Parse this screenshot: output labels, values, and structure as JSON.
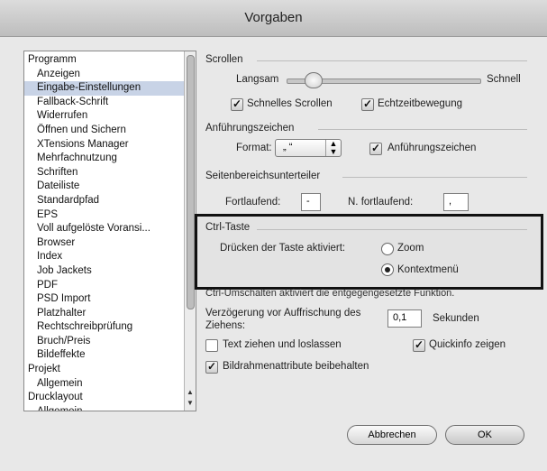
{
  "window": {
    "title": "Vorgaben"
  },
  "sidebar": {
    "items": [
      {
        "label": "Programm",
        "level": 0,
        "selected": false
      },
      {
        "label": "Anzeigen",
        "level": 1,
        "selected": false
      },
      {
        "label": "Eingabe-Einstellungen",
        "level": 1,
        "selected": true
      },
      {
        "label": "Fallback-Schrift",
        "level": 1,
        "selected": false
      },
      {
        "label": "Widerrufen",
        "level": 1,
        "selected": false
      },
      {
        "label": "Öffnen und Sichern",
        "level": 1,
        "selected": false
      },
      {
        "label": "XTensions Manager",
        "level": 1,
        "selected": false
      },
      {
        "label": "Mehrfachnutzung",
        "level": 1,
        "selected": false
      },
      {
        "label": "Schriften",
        "level": 1,
        "selected": false
      },
      {
        "label": "Dateiliste",
        "level": 1,
        "selected": false
      },
      {
        "label": "Standardpfad",
        "level": 1,
        "selected": false
      },
      {
        "label": "EPS",
        "level": 1,
        "selected": false
      },
      {
        "label": "Voll aufgelöste Voransi...",
        "level": 1,
        "selected": false
      },
      {
        "label": "Browser",
        "level": 1,
        "selected": false
      },
      {
        "label": "Index",
        "level": 1,
        "selected": false
      },
      {
        "label": "Job Jackets",
        "level": 1,
        "selected": false
      },
      {
        "label": "PDF",
        "level": 1,
        "selected": false
      },
      {
        "label": "PSD Import",
        "level": 1,
        "selected": false
      },
      {
        "label": "Platzhalter",
        "level": 1,
        "selected": false
      },
      {
        "label": "Rechtschreibprüfung",
        "level": 1,
        "selected": false
      },
      {
        "label": "Bruch/Preis",
        "level": 1,
        "selected": false
      },
      {
        "label": "Bildeffekte",
        "level": 1,
        "selected": false
      },
      {
        "label": "Projekt",
        "level": 0,
        "selected": false
      },
      {
        "label": "Allgemein",
        "level": 1,
        "selected": false
      },
      {
        "label": "Drucklayout",
        "level": 0,
        "selected": false
      },
      {
        "label": "Allgemein",
        "level": 1,
        "selected": false
      }
    ]
  },
  "scrollen": {
    "title": "Scrollen",
    "slow_label": "Langsam",
    "fast_label": "Schnell",
    "slider_value": 0.1,
    "fast_scroll_label": "Schnelles Scrollen",
    "fast_scroll_checked": true,
    "live_scroll_label": "Echtzeitbewegung",
    "live_scroll_checked": true
  },
  "quotes": {
    "title": "Anführungszeichen",
    "format_label": "Format:",
    "format_value": "„ “",
    "smart_quotes_label": "Anführungszeichen",
    "smart_quotes_checked": true
  },
  "page_range": {
    "title": "Seitenbereichsunterteiler",
    "continuous_label": "Fortlaufend:",
    "continuous_value": "-",
    "non_continuous_label": "N. fortlaufend:",
    "non_continuous_value": ","
  },
  "ctrl_key": {
    "title": "Ctrl-Taste",
    "press_label": "Drücken der Taste aktiviert:",
    "option_zoom": "Zoom",
    "option_context": "Kontextmenü",
    "selected": "Kontextmenü"
  },
  "note": "Ctrl-Umschalten aktiviert die entgegengesetzte Funktion.",
  "drag": {
    "delay_label": "Verzögerung vor Auffrischung des Ziehens:",
    "delay_value": "0,1",
    "seconds_label": "Sekunden",
    "drag_drop_label": "Text ziehen und loslassen",
    "drag_drop_checked": false,
    "tooltips_label": "Quickinfo zeigen",
    "tooltips_checked": true,
    "keep_frame_label": "Bildrahmenattribute beibehalten",
    "keep_frame_checked": true
  },
  "buttons": {
    "cancel": "Abbrechen",
    "ok": "OK"
  }
}
